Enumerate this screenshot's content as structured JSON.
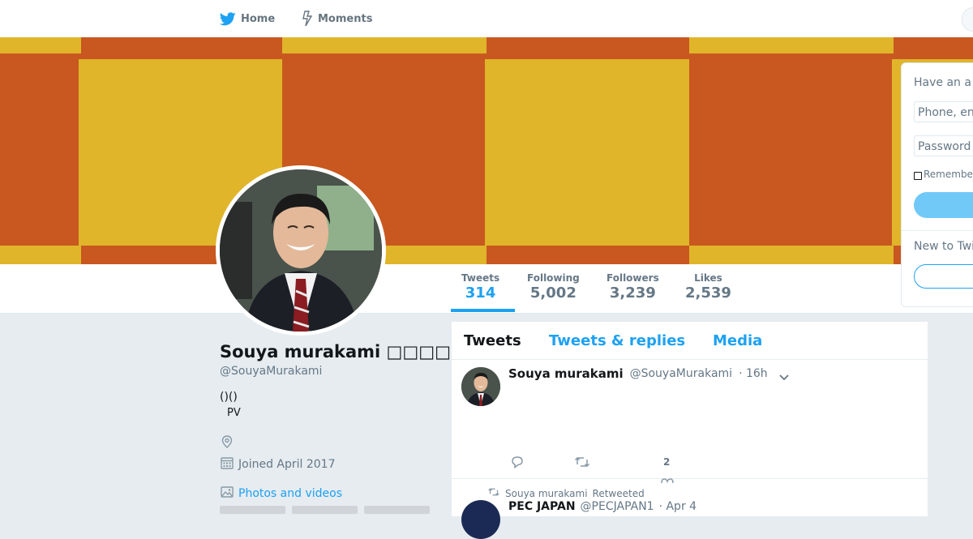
{
  "nav": {
    "home_label": "Home",
    "moments_label": "Moments"
  },
  "profile": {
    "name": "Souya murakami □□□□",
    "handle": "@SouyaMurakami",
    "bio_line1": "()()",
    "bio_line2": "PV",
    "joined": "Joined April 2017",
    "photos_label": "Photos and videos"
  },
  "stats": {
    "tweets_label": "Tweets",
    "tweets_value": "314",
    "following_label": "Following",
    "following_value": "5,002",
    "followers_label": "Followers",
    "followers_value": "3,239",
    "likes_label": "Likes",
    "likes_value": "2,539"
  },
  "timeline": {
    "tabs": [
      "Tweets",
      "Tweets & replies",
      "Media"
    ],
    "tweet1": {
      "name": "Souya murakami",
      "handle": "@SouyaMurakami",
      "time": "· 16h",
      "like_count": "2"
    },
    "tweet2": {
      "retweet_by": "Souya murakami",
      "retweeted_label": "Retweeted",
      "name": "PEC JAPAN",
      "handle": "@PECJAPAN1",
      "time": "· Apr 4"
    }
  },
  "login": {
    "title": "Have an a",
    "phone_placeholder": "Phone, en",
    "password_placeholder": "Password",
    "remember_label": "Remembe",
    "new_to": "New to Twi"
  },
  "colors": {
    "accent": "#1da1f2",
    "banner_orange": "#c8581f",
    "banner_yellow": "#e0b52a",
    "page_bg": "#e6ecf0"
  },
  "icons": {
    "home": "twitter-bird-icon",
    "moments": "lightning-icon",
    "location": "location-pin-icon",
    "joined": "calendar-icon",
    "photos": "image-icon",
    "reply": "reply-icon",
    "retweet": "retweet-icon",
    "like": "heart-icon",
    "caret": "chevron-down-icon"
  }
}
